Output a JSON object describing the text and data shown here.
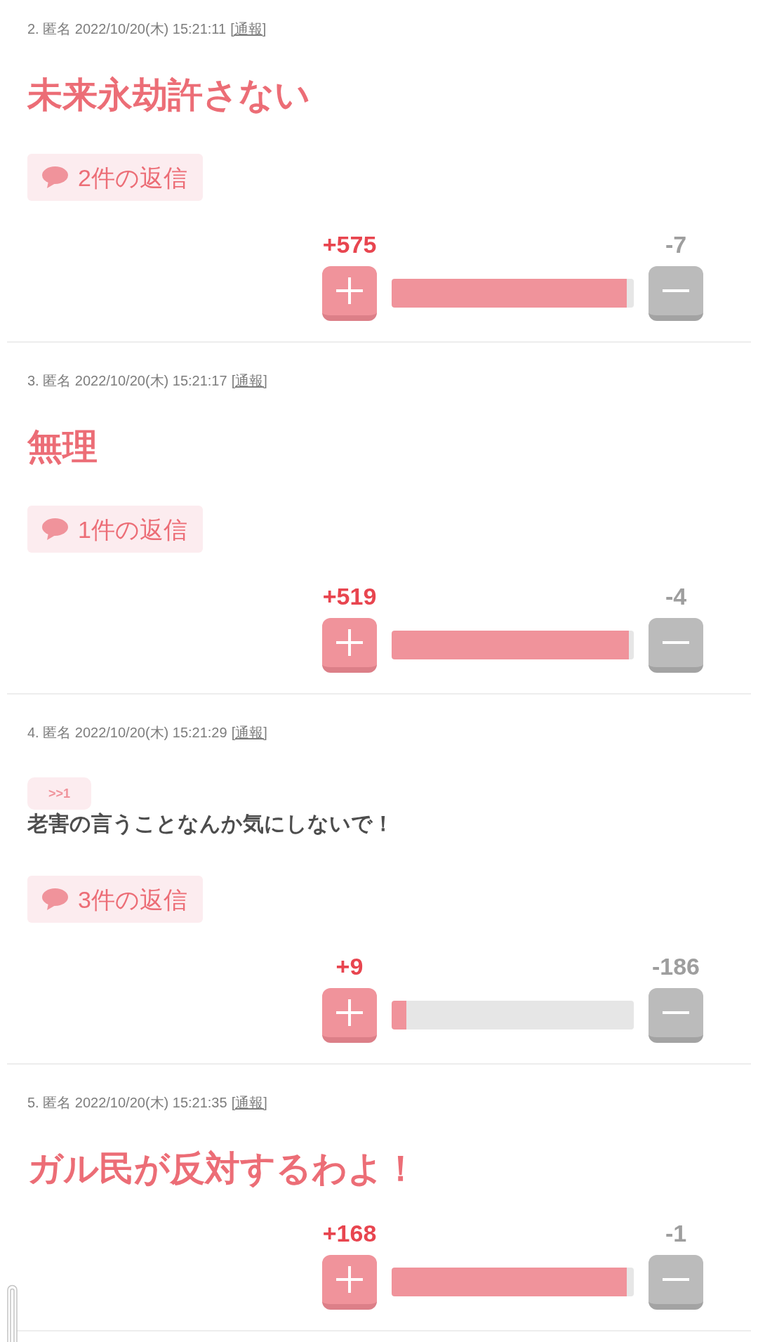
{
  "comments": [
    {
      "meta": "2. 匿名 2022/10/20(木) 15:21:11",
      "report": "[通報]",
      "body": {
        "kind": "headline",
        "text": "未来永劫許さない"
      },
      "replies": "2件の返信",
      "votes": {
        "plus": "+575",
        "minus": "-7",
        "level": 0.97
      }
    },
    {
      "meta": "3. 匿名 2022/10/20(木) 15:21:17",
      "report": "[通報]",
      "body": {
        "kind": "headline",
        "text": "無理"
      },
      "replies": "1件の返信",
      "votes": {
        "plus": "+519",
        "minus": "-4",
        "level": 0.98
      }
    },
    {
      "meta": "4. 匿名 2022/10/20(木) 15:21:29",
      "report": "[通報]",
      "anchor": ">>1",
      "body": {
        "kind": "plain",
        "text": "老害の言うことなんか気にしないで！"
      },
      "replies": "3件の返信",
      "votes": {
        "plus": "+9",
        "minus": "-186",
        "level": 0.06
      }
    },
    {
      "meta": "5. 匿名 2022/10/20(木) 15:21:35",
      "report": "[通報]",
      "body": {
        "kind": "headline",
        "text": "ガル民が反対するわよ！"
      },
      "votes": {
        "plus": "+168",
        "minus": "-1",
        "level": 0.97
      }
    }
  ]
}
